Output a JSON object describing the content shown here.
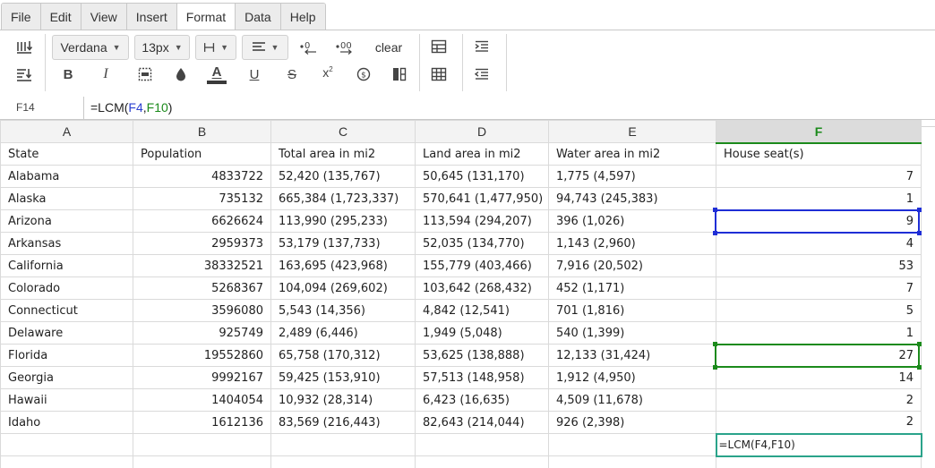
{
  "menu": {
    "items": [
      "File",
      "Edit",
      "View",
      "Insert",
      "Format",
      "Data",
      "Help"
    ],
    "active": "Format"
  },
  "toolbar": {
    "font_family": "Verdana",
    "font_size": "13px",
    "clear_label": "clear",
    "superscript_label": "x",
    "icons": [
      "wrap-text-icon",
      "sort-icon",
      "font-family-dropdown",
      "font-size-dropdown",
      "borders-icon",
      "align-icon",
      "decrease-decimal-icon",
      "increase-decimal-icon",
      "table-icon",
      "indent-icon",
      "bold-icon",
      "italic-icon",
      "merge-icon",
      "fill-color-icon",
      "text-color-icon",
      "underline-icon",
      "strikethrough-icon",
      "superscript-icon",
      "currency-icon",
      "columns-icon",
      "grid-icon",
      "outdent-icon"
    ]
  },
  "formula_bar": {
    "cell_ref": "F14",
    "formula_prefix": "=LCM(",
    "ref1": "F4",
    "comma": ",",
    "ref2": "F10",
    "formula_suffix": ")"
  },
  "grid": {
    "columns": [
      "A",
      "B",
      "C",
      "D",
      "E",
      "F"
    ],
    "selected_column": "F",
    "header_row": [
      "State",
      "Population",
      "Total area in mi2",
      "Land area in mi2",
      "Water area in mi2",
      "House seat(s)"
    ],
    "rows": [
      [
        "Alabama",
        "4833722",
        "52,420 (135,767)",
        "50,645 (131,170)",
        "1,775 (4,597)",
        "7"
      ],
      [
        "Alaska",
        "735132",
        "665,384 (1,723,337)",
        "570,641 (1,477,950)",
        "94,743 (245,383)",
        "1"
      ],
      [
        "Arizona",
        "6626624",
        "113,990 (295,233)",
        "113,594 (294,207)",
        "396 (1,026)",
        "9"
      ],
      [
        "Arkansas",
        "2959373",
        "53,179 (137,733)",
        "52,035 (134,770)",
        "1,143 (2,960)",
        "4"
      ],
      [
        "California",
        "38332521",
        "163,695 (423,968)",
        "155,779 (403,466)",
        "7,916 (20,502)",
        "53"
      ],
      [
        "Colorado",
        "5268367",
        "104,094 (269,602)",
        "103,642 (268,432)",
        "452 (1,171)",
        "7"
      ],
      [
        "Connecticut",
        "3596080",
        "5,543 (14,356)",
        "4,842 (12,541)",
        "701 (1,816)",
        "5"
      ],
      [
        "Delaware",
        "925749",
        "2,489 (6,446)",
        "1,949 (5,048)",
        "540 (1,399)",
        "1"
      ],
      [
        "Florida",
        "19552860",
        "65,758 (170,312)",
        "53,625 (138,888)",
        "12,133 (31,424)",
        "27"
      ],
      [
        "Georgia",
        "9992167",
        "59,425 (153,910)",
        "57,513 (148,958)",
        "1,912 (4,950)",
        "14"
      ],
      [
        "Hawaii",
        "1404054",
        "10,932 (28,314)",
        "6,423 (16,635)",
        "4,509 (11,678)",
        "2"
      ],
      [
        "Idaho",
        "1612136",
        "83,569 (216,443)",
        "82,643 (214,044)",
        "926 (2,398)",
        "2"
      ]
    ],
    "editing_cell_text": "=LCM(F4,F10)"
  }
}
